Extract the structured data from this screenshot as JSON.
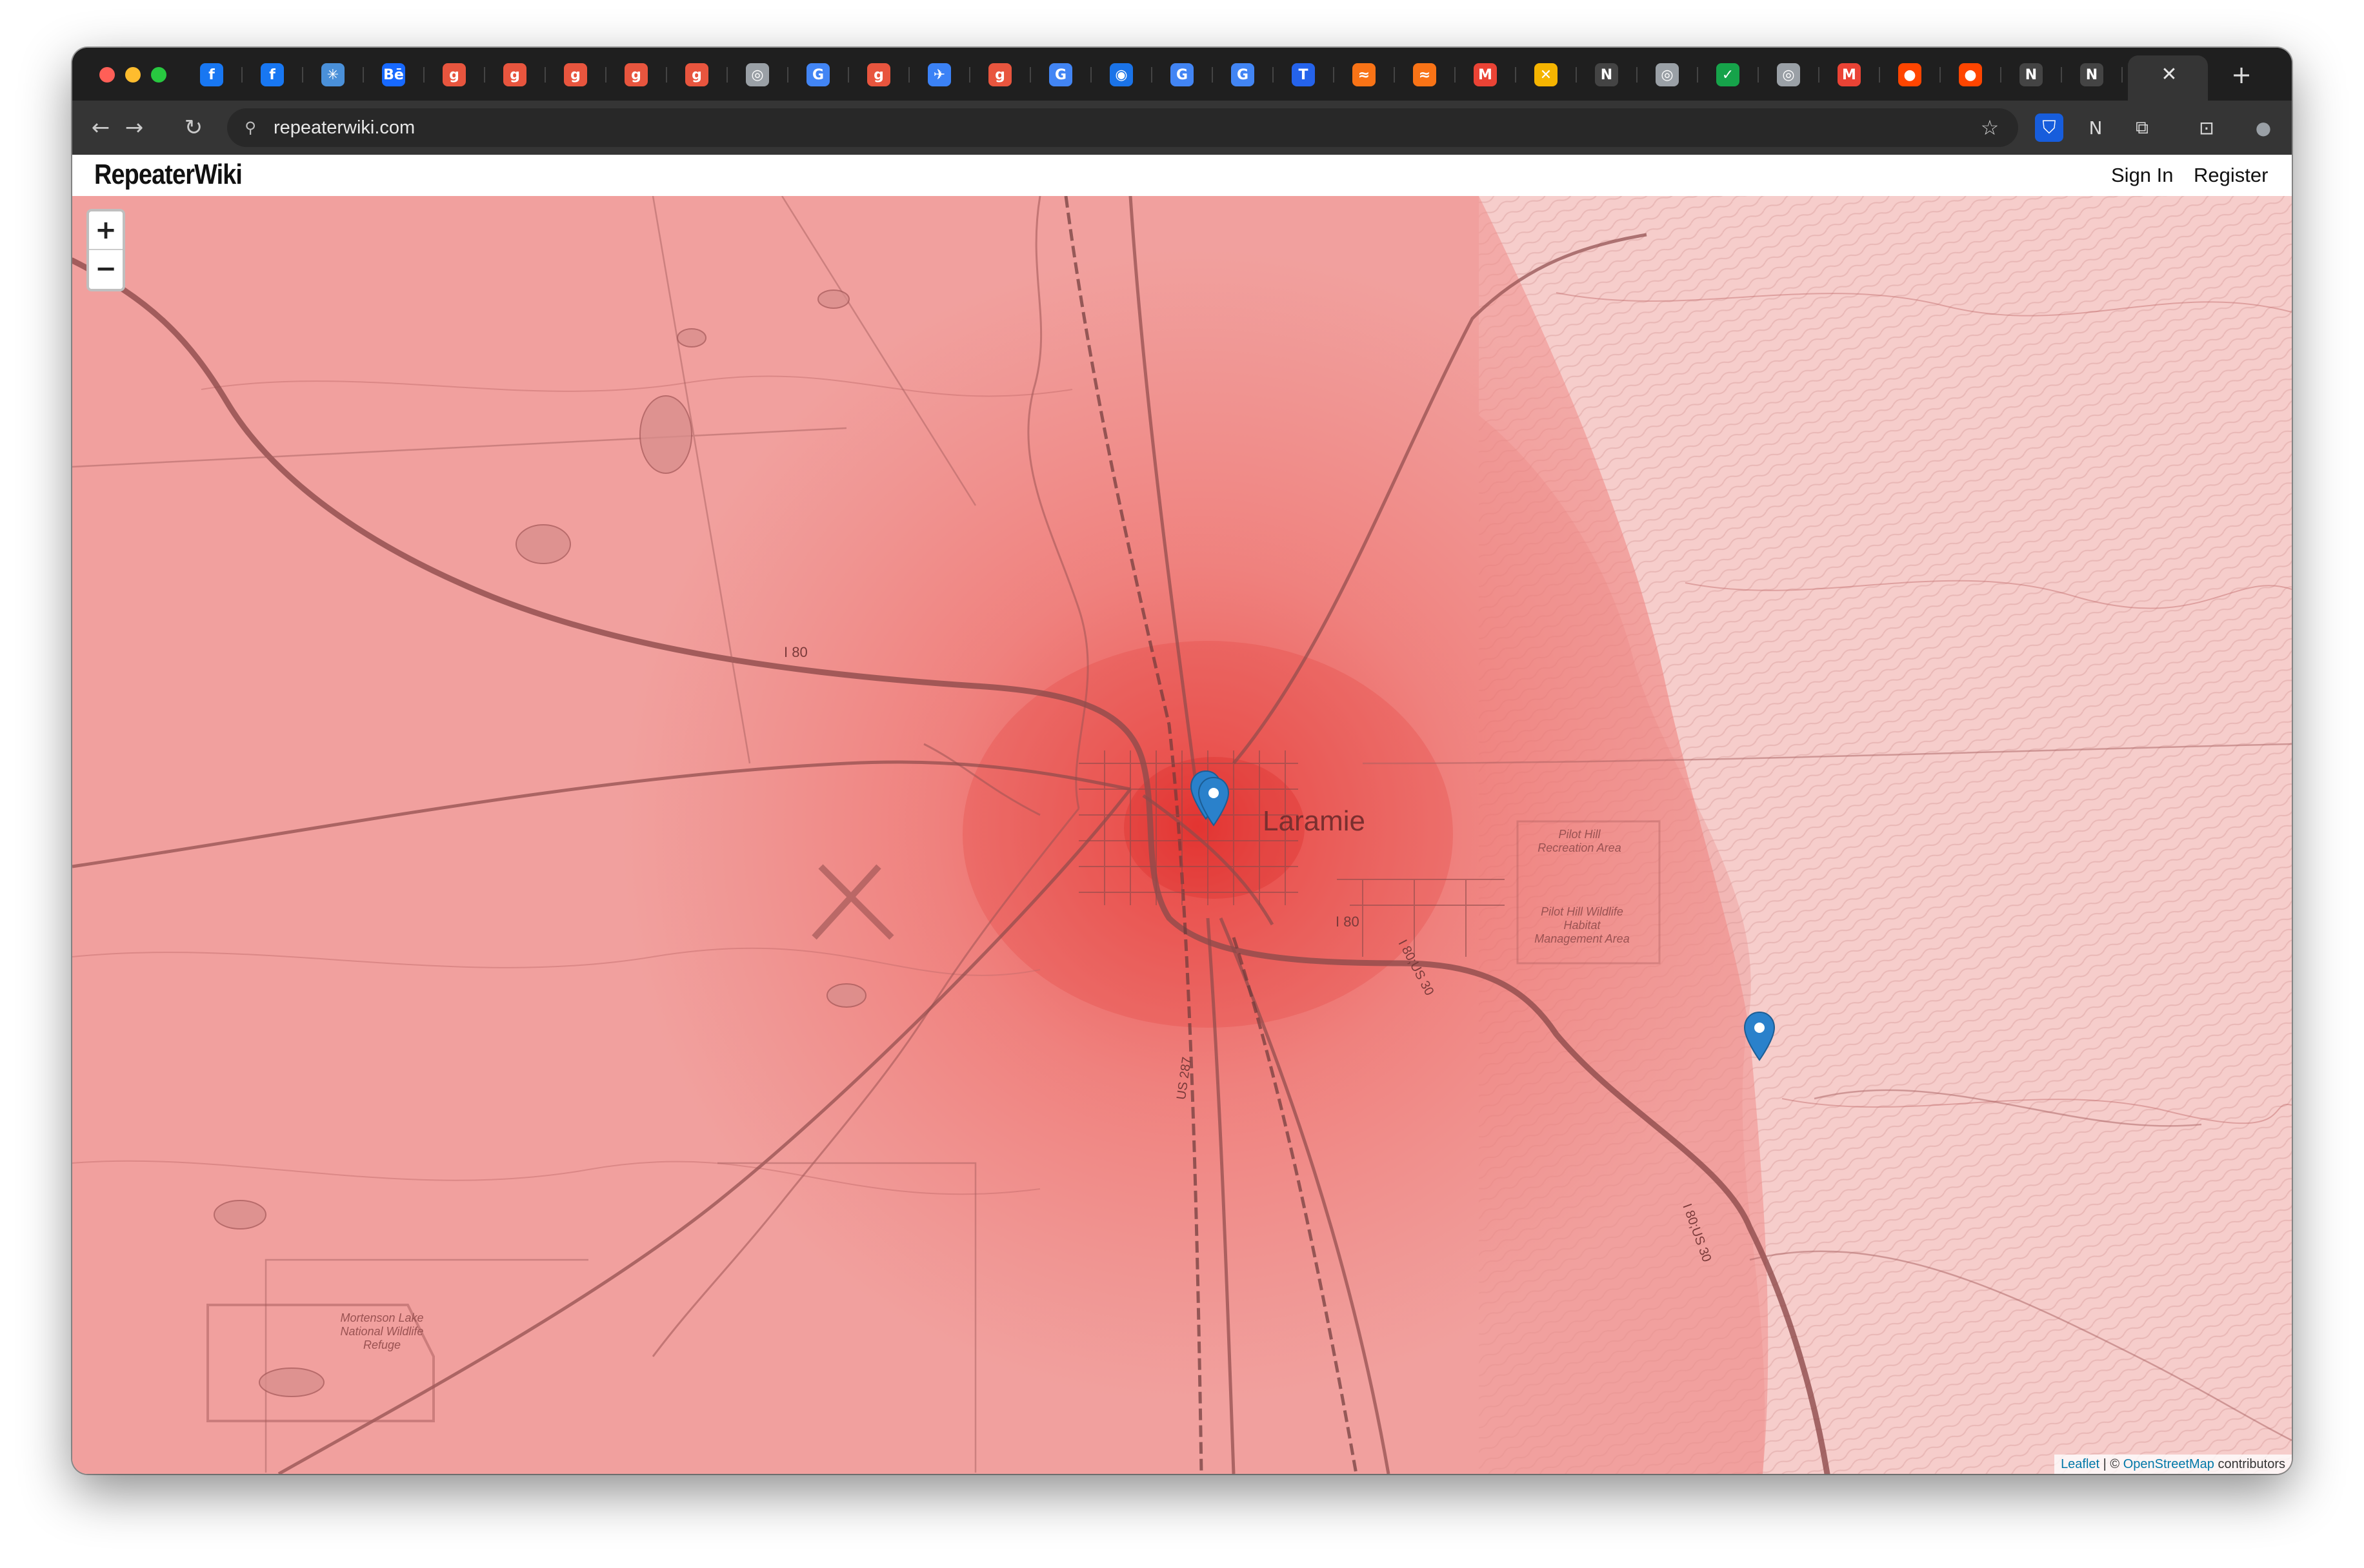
{
  "browser": {
    "address": "repeaterwiki.com",
    "tab_favicons": [
      {
        "icon": "facebook-icon",
        "glyph": "f",
        "color": "#1877f2"
      },
      {
        "icon": "facebook-icon",
        "glyph": "f",
        "color": "#1877f2"
      },
      {
        "icon": "web-icon",
        "glyph": "✳",
        "color": "#4a90d9"
      },
      {
        "icon": "behance-icon",
        "glyph": "Bē",
        "color": "#1769ff"
      },
      {
        "icon": "g-app-icon",
        "glyph": "g",
        "color": "#e8553e"
      },
      {
        "icon": "g-app-icon",
        "glyph": "g",
        "color": "#e8553e"
      },
      {
        "icon": "g-app-icon",
        "glyph": "g",
        "color": "#e8553e"
      },
      {
        "icon": "g-app-icon",
        "glyph": "g",
        "color": "#e8553e"
      },
      {
        "icon": "g-app-icon",
        "glyph": "g",
        "color": "#e8553e"
      },
      {
        "icon": "chrome-icon",
        "glyph": "◎",
        "color": "#9aa0a6"
      },
      {
        "icon": "google-icon",
        "glyph": "G",
        "color": "#4285f4"
      },
      {
        "icon": "g-app-icon",
        "glyph": "g",
        "color": "#e8553e"
      },
      {
        "icon": "bird-icon",
        "glyph": "✈",
        "color": "#3b82f6"
      },
      {
        "icon": "g-app-icon",
        "glyph": "g",
        "color": "#e8553e"
      },
      {
        "icon": "google-icon",
        "glyph": "G",
        "color": "#4285f4"
      },
      {
        "icon": "blue-app-icon",
        "glyph": "◉",
        "color": "#1a73e8"
      },
      {
        "icon": "google-icon",
        "glyph": "G",
        "color": "#4285f4"
      },
      {
        "icon": "google-icon",
        "glyph": "G",
        "color": "#4285f4"
      },
      {
        "icon": "t-app-icon",
        "glyph": "T",
        "color": "#2563eb"
      },
      {
        "icon": "orange-app-icon",
        "glyph": "≈",
        "color": "#f97316"
      },
      {
        "icon": "orange-app-icon",
        "glyph": "≈",
        "color": "#f97316"
      },
      {
        "icon": "gmail-icon",
        "glyph": "M",
        "color": "#ea4335"
      },
      {
        "icon": "yellow-app-icon",
        "glyph": "✕",
        "color": "#f5b400"
      },
      {
        "icon": "notion-icon",
        "glyph": "N",
        "color": "#444444"
      },
      {
        "icon": "chrome-icon",
        "glyph": "◎",
        "color": "#9aa0a6"
      },
      {
        "icon": "check-icon",
        "glyph": "✓",
        "color": "#16a34a"
      },
      {
        "icon": "chrome-icon",
        "glyph": "◎",
        "color": "#9aa0a6"
      },
      {
        "icon": "gmail-icon",
        "glyph": "M",
        "color": "#ea4335"
      },
      {
        "icon": "reddit-icon",
        "glyph": "●",
        "color": "#ff4500"
      },
      {
        "icon": "reddit-icon",
        "glyph": "●",
        "color": "#ff4500"
      },
      {
        "icon": "notion-icon",
        "glyph": "N",
        "color": "#444444"
      },
      {
        "icon": "notion-icon",
        "glyph": "N",
        "color": "#444444"
      }
    ],
    "close_glyph": "✕",
    "new_tab_glyph": "+",
    "nav": {
      "back": "←",
      "forward": "→",
      "reload": "↻"
    },
    "site_info_icon": "⚲",
    "bookmark_icon": "☆",
    "extensions": [
      {
        "icon": "bitwarden-icon",
        "glyph": "⛉"
      },
      {
        "icon": "notion-icon",
        "glyph": "N"
      },
      {
        "icon": "puzzle-icon",
        "glyph": "⧉"
      },
      {
        "icon": "sidepanel-icon",
        "glyph": "⊡"
      },
      {
        "icon": "profile-avatar-icon",
        "glyph": "●"
      },
      {
        "icon": "menu-icon",
        "glyph": "⋮"
      }
    ]
  },
  "site": {
    "brand": "RepeaterWiki",
    "sign_in": "Sign In",
    "register": "Register"
  },
  "map": {
    "zoom_in": "+",
    "zoom_out": "−",
    "attribution": {
      "leaflet": "Leaflet",
      "separator": " | © ",
      "osm": "OpenStreetMap",
      "suffix": " contributors"
    },
    "labels": {
      "city": "Laramie",
      "i80_west": "I 80",
      "i80_east": "I 80",
      "i80_us30_a": "I 80;US 30",
      "i80_us30_b": "I 80;US 30",
      "us287": "US 287",
      "pilot_hill_rec_1": "Pilot Hill",
      "pilot_hill_rec_2": "Recreation Area",
      "pilot_hill_wma_1": "Pilot Hill Wildlife",
      "pilot_hill_wma_2": "Habitat",
      "pilot_hill_wma_3": "Management Area",
      "mortenson_1": "Mortenson Lake",
      "mortenson_2": "National Wildlife",
      "mortenson_3": "Refuge"
    },
    "markers": [
      {
        "name": "repeater-marker-laramie"
      },
      {
        "name": "repeater-marker-east"
      }
    ],
    "coverage_color": "#e53935",
    "marker_color": "#2a81cb"
  }
}
